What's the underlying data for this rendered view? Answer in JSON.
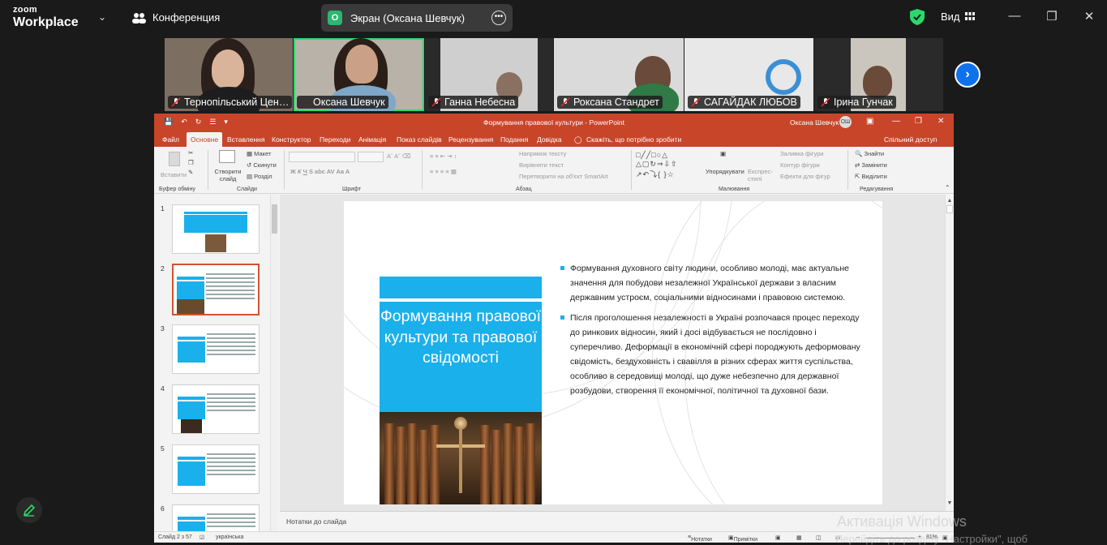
{
  "zoom": {
    "logo_top": "zoom",
    "logo_bottom": "Workplace",
    "conference_label": "Конференция",
    "screen_share_badge": "O",
    "screen_share_label": "Экран (Оксана Шевчук)",
    "view_label": "Вид",
    "icons": [
      "chevron-down-icon",
      "participants-icon",
      "more-icon",
      "shield-icon",
      "grid-icon",
      "minimize-icon",
      "maximize-icon",
      "close-icon",
      "next-icon",
      "pen-icon",
      "mic-muted-icon"
    ],
    "accent_color": "#0e72ed",
    "active_speaker_color": "#2bd96b",
    "participants": [
      {
        "name": "Тернопільський Цен…"
      },
      {
        "name": "Оксана Шевчук"
      },
      {
        "name": "Ганна Небесна"
      },
      {
        "name": "Роксана Стандрет"
      },
      {
        "name": "САГАЙДАК ЛЮБОВ"
      },
      {
        "name": "Ірина Гунчак"
      }
    ]
  },
  "ppt": {
    "window_title": "Формування правової культури  -  PowerPoint",
    "user_name": "Оксана Шевчук",
    "user_initials": "ОШ",
    "theme_color": "#c8452a",
    "menu": [
      "Файл",
      "Основне",
      "Вставлення",
      "Конструктор",
      "Переходи",
      "Анімація",
      "Показ слайдів",
      "Рецензування",
      "Подання",
      "Довідка"
    ],
    "tell_me": "Скажіть, що потрібно зробити",
    "share": "Спільний доступ",
    "ribbon": {
      "paste": "Вставити",
      "new_slide": "Створити слайд",
      "layout": "Макет",
      "reset": "Скинути",
      "section": "Розділ",
      "text_direction": "Напрямок тексту",
      "align_text": "Вирівняти текст",
      "smartart": "Перетворити на об'єкт SmartArt",
      "arrange": "Упорядкувати",
      "quick_styles": "Експрес-стилі",
      "fill": "Заливка фігури",
      "outline": "Контур фігури",
      "effects": "Ефекти для фігур",
      "find": "Знайти",
      "replace": "Замінити",
      "select": "Виділити",
      "groups": [
        "Буфер обміну",
        "Слайди",
        "Шрифт",
        "Абзац",
        "Малювання",
        "Редагування"
      ]
    },
    "slide_numbers": [
      "1",
      "2",
      "3",
      "4",
      "5",
      "6"
    ],
    "selected_slide": 2,
    "slide": {
      "title": "Формування правової культури та правової свідомості",
      "bullets": [
        "Формування духовного світу людини, особливо молоді, має актуальне значення для побудови незалежної Української держави з власним державним устроєм, соціальними відносинами і правовою системою.",
        "Після проголошення незалежності в Україні розпочався процес переходу до ринкових відносин, який і досі відбувається не послідовно і суперечливо. Деформації в економічній сфері породжують деформовану свідомість, бездуховність і свавілля в різних сферах життя суспільства, особливо в середовищі молоді, що дуже небезпечно для державної розбудови, створення її економічної, політичної та духовної бази."
      ],
      "accent": "#1ab0ec"
    },
    "notes_placeholder": "Нотатки до слайда",
    "status": {
      "slide_counter": "Слайд 2 з 57",
      "language": "українська",
      "notes_btn": "Нотатки",
      "comments_btn": "Примітки",
      "zoom_percent": "81%"
    }
  },
  "watermark": {
    "line1": "Активація Windows",
    "line2": "Перейдіть до розділу \"Настройки\", щоб"
  }
}
